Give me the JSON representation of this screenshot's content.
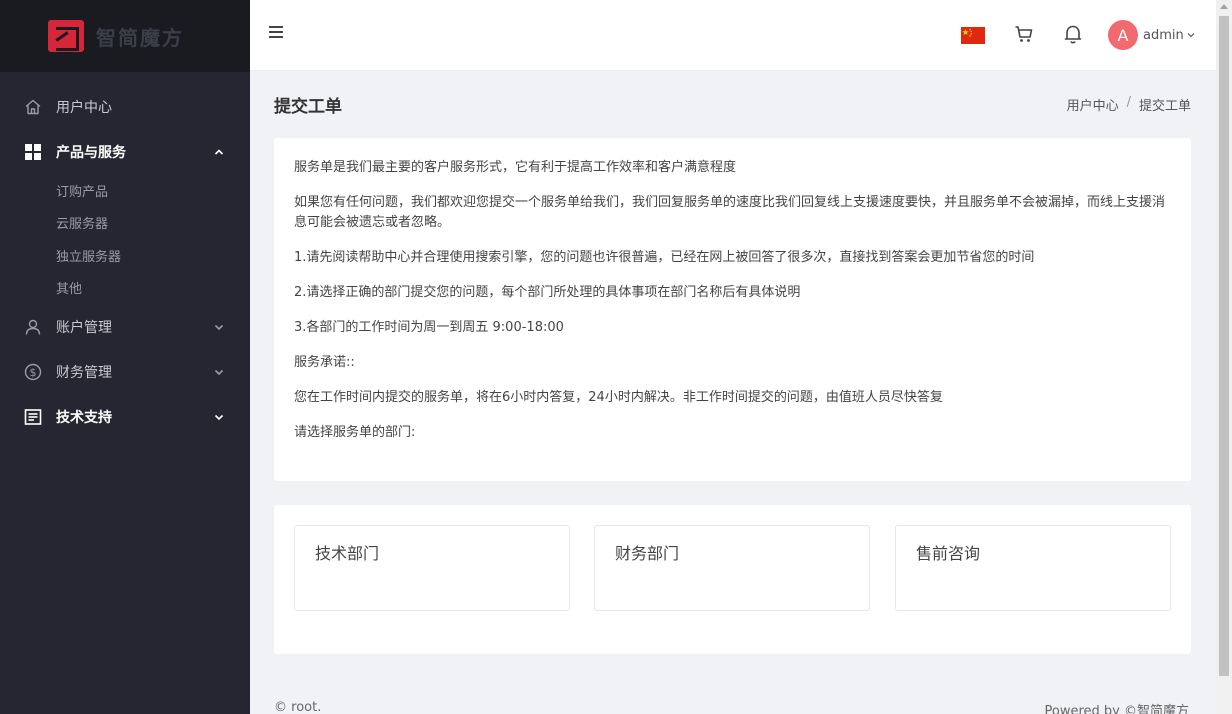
{
  "sidebar": {
    "logo_text": "智简魔方",
    "nav": [
      {
        "label": "用户中心",
        "icon": "home-icon"
      },
      {
        "label": "产品与服务",
        "icon": "grid-icon",
        "expanded": true,
        "children": [
          "订购产品",
          "云服务器",
          "独立服务器",
          "其他"
        ]
      },
      {
        "label": "账户管理",
        "icon": "user-icon"
      },
      {
        "label": "财务管理",
        "icon": "dollar-icon"
      },
      {
        "label": "技术支持",
        "icon": "ticket-icon"
      }
    ]
  },
  "header": {
    "user_initial": "A",
    "username": "admin",
    "flag_color": "#de2910",
    "avatar_color": "#f06a6f"
  },
  "page": {
    "title": "提交工单",
    "breadcrumb": [
      "用户中心",
      "/",
      "提交工单"
    ]
  },
  "intro": {
    "paragraphs": [
      "服务单是我们最主要的客户服务形式，它有利于提高工作效率和客户满意程度",
      "如果您有任何问题，我们都欢迎您提交一个服务单给我们，我们回复服务单的速度比我们回复线上支援速度要快，并且服务单不会被漏掉，而线上支援消息可能会被遗忘或者忽略。",
      "1.请先阅读帮助中心并合理使用搜索引擎，您的问题也许很普遍，已经在网上被回答了很多次，直接找到答案会更加节省您的时间",
      "2.请选择正确的部门提交您的问题，每个部门所处理的具体事项在部门名称后有具体说明",
      "3.各部门的工作时间为周一到周五 9:00-18:00",
      "服务承诺::",
      "您在工作时间内提交的服务单，将在6小时内答复，24小时内解决。非工作时间提交的问题，由值班人员尽快答复",
      "请选择服务单的部门:"
    ]
  },
  "departments": [
    "技术部门",
    "财务部门",
    "售前咨询"
  ],
  "footer": {
    "left": "© root.",
    "right": "Powered by ©智简魔方"
  }
}
